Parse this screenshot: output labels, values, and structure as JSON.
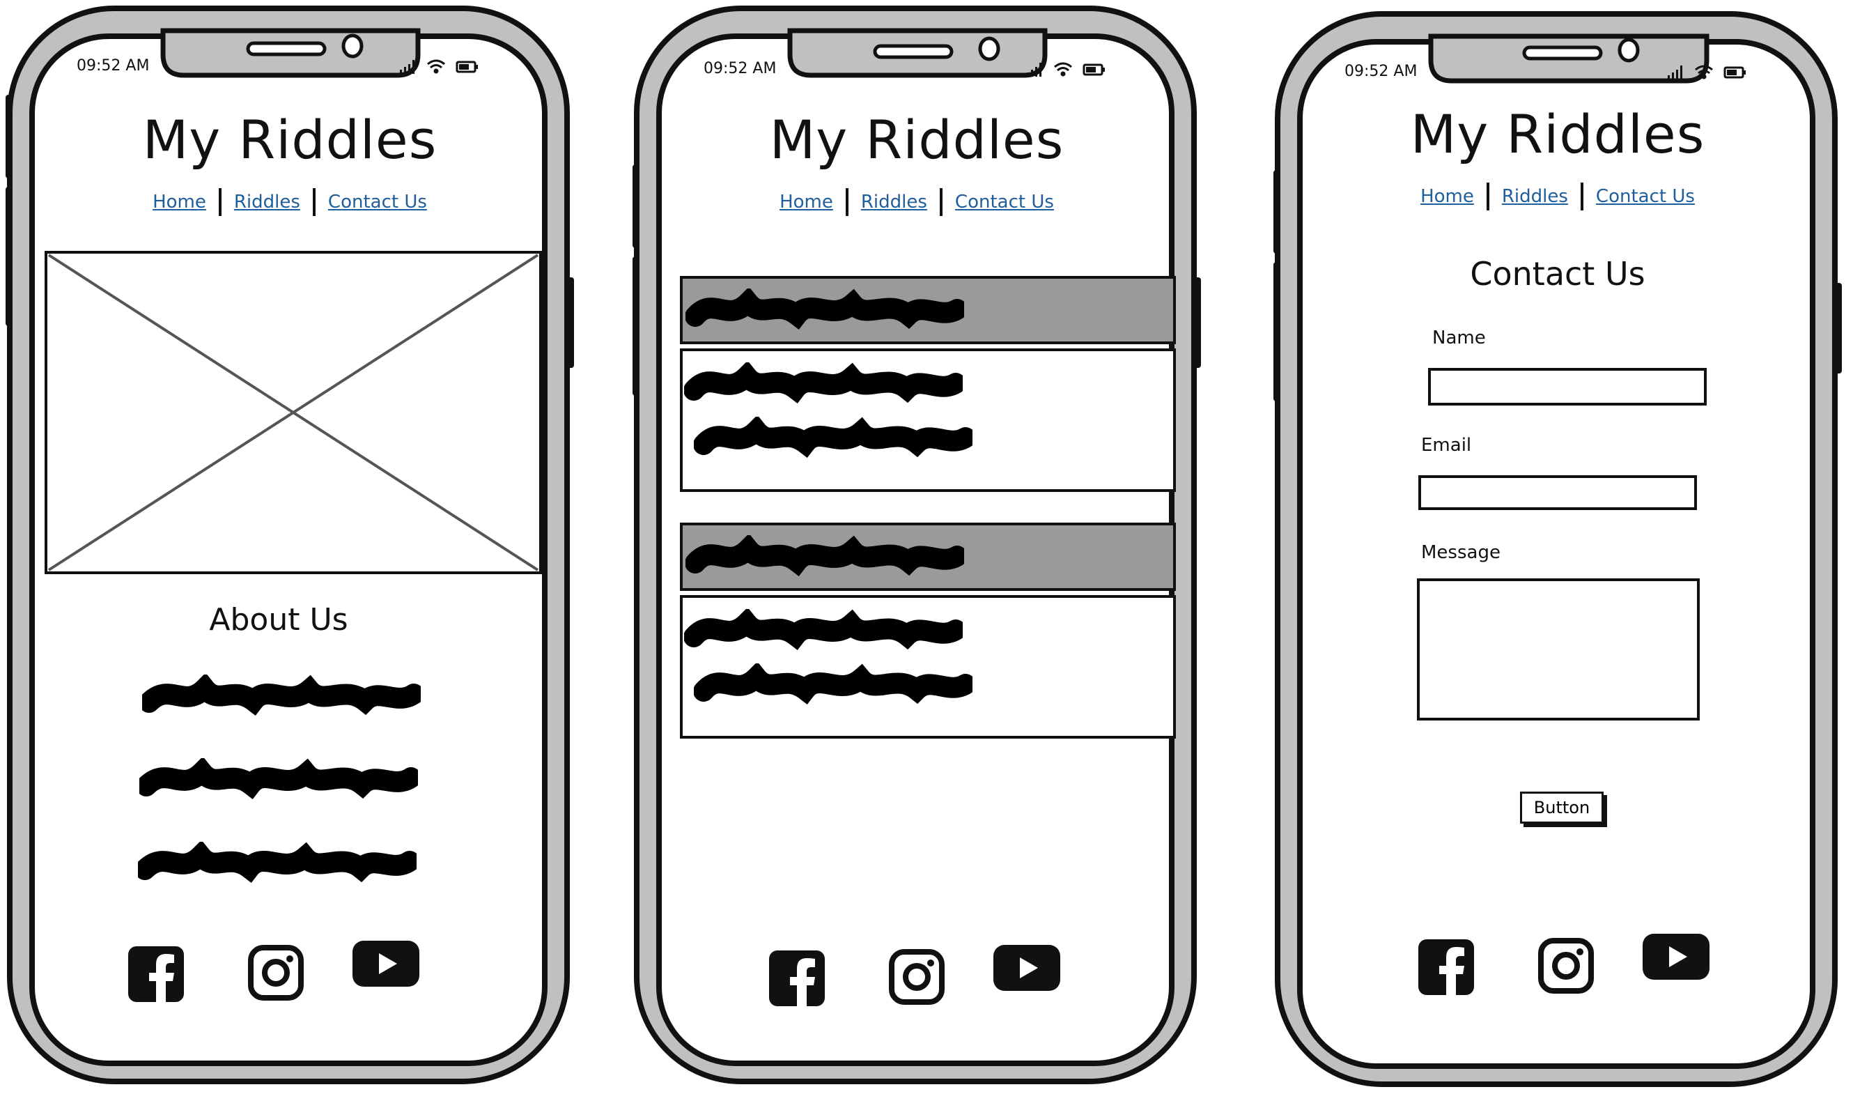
{
  "status_bar": {
    "time": "09:52 AM"
  },
  "app": {
    "title": "My Riddles"
  },
  "nav": {
    "home": "Home",
    "riddles": "Riddles",
    "contact": "Contact Us"
  },
  "home_screen": {
    "about_heading": "About Us"
  },
  "contact_screen": {
    "heading": "Contact Us",
    "name_label": "Name",
    "email_label": "Email",
    "message_label": "Message",
    "button_label": "Button"
  },
  "icons": [
    "facebook-icon",
    "instagram-icon",
    "youtube-icon",
    "signal-icon",
    "wifi-icon",
    "battery-icon"
  ],
  "colors": {
    "frame": "#c0c0c0",
    "outline": "#111111",
    "link": "#1f5e9c",
    "panel_header": "#9a9a9a"
  }
}
